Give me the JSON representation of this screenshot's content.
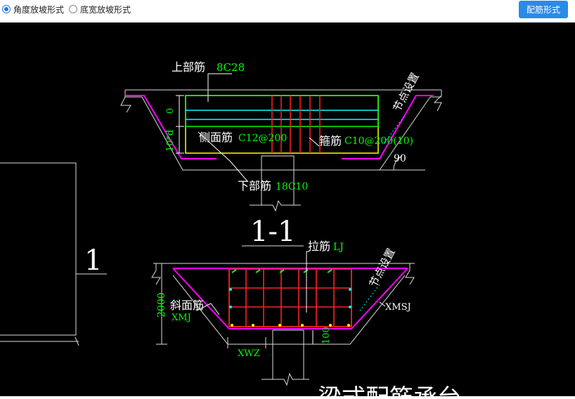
{
  "toolbar": {
    "option1": "角度放坡形式",
    "option2": "底宽放坡形式",
    "button": "配筋形式"
  },
  "drawing": {
    "top_rebar_label": "上部筋",
    "top_rebar_value": "8C28",
    "side_rebar_label": "侧面筋",
    "side_rebar_value": "C12@200",
    "stirrup_label": "箍筋",
    "stirrup_value": "C10@200(10)",
    "bottom_rebar_label": "下部筋",
    "bottom_rebar_value": "18C10",
    "node_setting_1": "节点设置",
    "angle_value": "90",
    "dim_zero": "0",
    "dim_10d": "10*d",
    "section_label": "1-1",
    "side_number": "1",
    "tie_label": "拉筋",
    "tie_value": "LJ",
    "slope_rebar_label": "斜面筋",
    "slope_rebar_value": "XMJ",
    "node_setting_2": "节点设置",
    "xmsj_value": "XMSJ",
    "height_value": "2000",
    "xwz_value": "XWZ",
    "dim_100": "100",
    "title": "梁式配筋承台"
  }
}
